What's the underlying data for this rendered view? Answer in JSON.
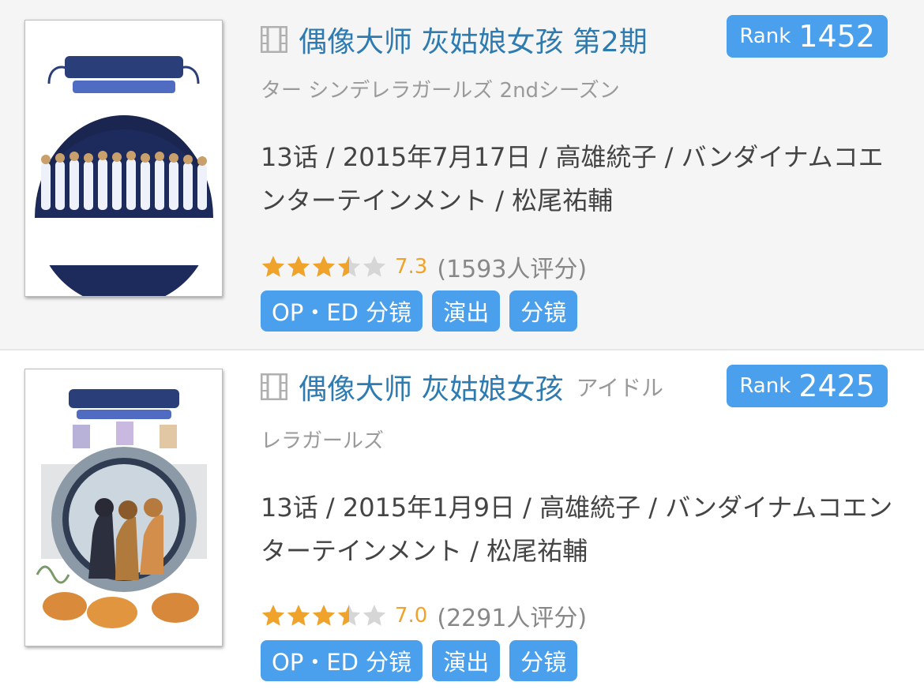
{
  "colors": {
    "link": "#2d7bb0",
    "tag_bg": "#4aa0ec",
    "star": "#f0a32a",
    "star_empty": "#d6d6d6"
  },
  "items": [
    {
      "title": "偶像大师 灰姑娘女孩 第2期",
      "original_title_tail": "",
      "original_title_rest": "ター シンデレラガールズ 2ndシーズン",
      "rank_label": "Rank",
      "rank_value": "1452",
      "info": "13话 / 2015年7月17日 / 高雄統子 / バンダイナムコエンターテインメント / 松尾祐輔",
      "stars": 3.5,
      "score": "7.3",
      "rating_count": "(1593人评分)",
      "tags": [
        "OP・ED 分镜",
        "演出",
        "分镜"
      ],
      "cover_icon": "anime-cover-image"
    },
    {
      "title": "偶像大师 灰姑娘女孩",
      "original_title_tail": "アイドル",
      "original_title_rest": "レラガールズ",
      "rank_label": "Rank",
      "rank_value": "2425",
      "info": "13话 / 2015年1月9日 / 高雄統子 / バンダイナムコエンターテインメント / 松尾祐輔",
      "stars": 3.5,
      "score": "7.0",
      "rating_count": "(2291人评分)",
      "tags": [
        "OP・ED 分镜",
        "演出",
        "分镜"
      ],
      "cover_icon": "anime-cover-image"
    }
  ]
}
